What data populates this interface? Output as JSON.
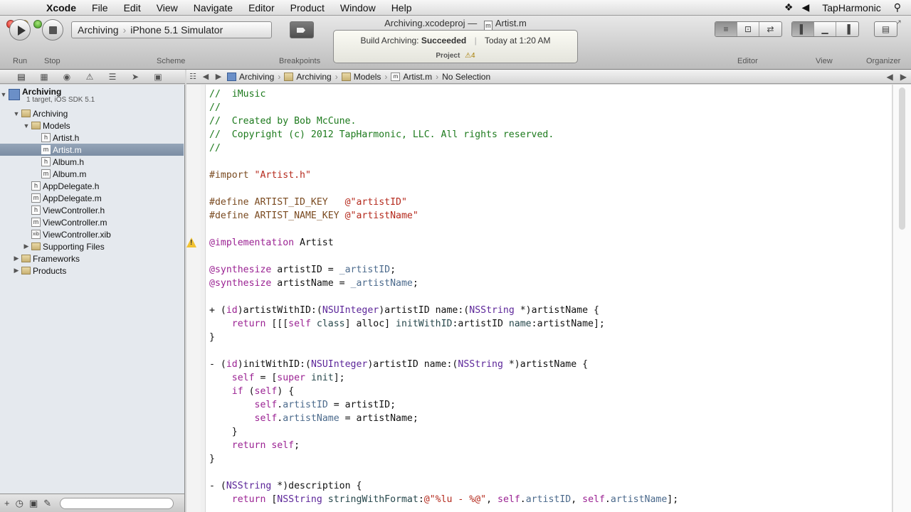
{
  "menubar": {
    "app": "Xcode",
    "items": [
      "File",
      "Edit",
      "View",
      "Navigate",
      "Editor",
      "Product",
      "Window",
      "Help"
    ],
    "user": "TapHarmonic"
  },
  "window": {
    "title_project": "Archiving.xcodeproj",
    "title_dash": "—",
    "title_file_icon": "m",
    "title_file": "Artist.m"
  },
  "toolbar": {
    "run_label": "Run",
    "stop_label": "Stop",
    "scheme_label": "Scheme",
    "scheme_name": "Archiving",
    "scheme_sep": "›",
    "scheme_destination": "iPhone 5.1 Simulator",
    "breakpoints_label": "Breakpoints",
    "editor_label": "Editor",
    "view_label": "View",
    "organizer_label": "Organizer"
  },
  "activity": {
    "build_prefix": "Build Archiving:",
    "build_status": "Succeeded",
    "pipe": "|",
    "time": "Today at 1:20 AM",
    "project_label": "Project",
    "warning_glyph": "⚠",
    "warning_count": "4"
  },
  "navigator": {
    "project_name": "Archiving",
    "project_sub": "1 target, iOS SDK 5.1",
    "items": [
      {
        "label": "Archiving",
        "icon": "folder"
      },
      {
        "label": "Models",
        "icon": "folder"
      },
      {
        "label": "Artist.h",
        "icon": "h"
      },
      {
        "label": "Artist.m",
        "icon": "m"
      },
      {
        "label": "Album.h",
        "icon": "h"
      },
      {
        "label": "Album.m",
        "icon": "m"
      },
      {
        "label": "AppDelegate.h",
        "icon": "h"
      },
      {
        "label": "AppDelegate.m",
        "icon": "m"
      },
      {
        "label": "ViewController.h",
        "icon": "h"
      },
      {
        "label": "ViewController.m",
        "icon": "m"
      },
      {
        "label": "ViewController.xib",
        "icon": "xib"
      },
      {
        "label": "Supporting Files",
        "icon": "folder"
      },
      {
        "label": "Frameworks",
        "icon": "folder"
      },
      {
        "label": "Products",
        "icon": "folder"
      }
    ]
  },
  "jumpbar": {
    "crumbs": [
      "Archiving",
      "Archiving",
      "Models",
      "Artist.m",
      "No Selection"
    ]
  },
  "code": {
    "l1": "//  iMusic",
    "l2": "//",
    "l3": "//  Created by Bob McCune.",
    "l4": "//  Copyright (c) 2012 TapHarmonic, LLC. All rights reserved.",
    "l5": "//",
    "import_kw": "#import",
    "import_str": "\"Artist.h\"",
    "define_kw": "#define",
    "define1_name": " ARTIST_ID_KEY   ",
    "define1_val": "@\"artistID\"",
    "define2_name": " ARTIST_NAME_KEY ",
    "define2_val": "@\"artistName\"",
    "impl_kw": "@implementation",
    "impl_name": " Artist",
    "synth_kw": "@synthesize",
    "synth1": " artistID = ",
    "synth1_ivar": "_artistID",
    "synth2": " artistName = ",
    "synth2_ivar": "_artistName",
    "m1_a": "+ (",
    "id_kw": "id",
    "m1_b": ")artistWithID:(",
    "nsuinteger": "NSUInteger",
    "m1_c": ")artistID name:(",
    "nsstring": "NSString",
    "m1_d": " *)artistName {",
    "m1_body_a": "    return [[[",
    "self_kw": "self",
    "class_kw": " class",
    "m1_body_b": "] alloc] ",
    "m1_body_c": "initWithID",
    "m1_body_d": ":artistID ",
    "name_kw": "name",
    "m1_body_e": ":artistName];",
    "close": "}",
    "m2_a": "- (",
    "m2_b": ")initWithID:(",
    "m2_c": ")artistID name:(",
    "m2_d": " *)artistName {",
    "m2_l1_a": "    ",
    "m2_l1_b": " = [",
    "super_kw": "super",
    "init_kw": " init",
    "m2_l1_c": "];",
    "if_kw": "if",
    "m2_l2_a": "    ",
    "m2_l2_b": " (",
    "m2_l2_c": ") {",
    "m2_l3_a": "        ",
    "dot": ".",
    "prop_artistID": "artistID",
    "m2_l3_b": " = artistID;",
    "prop_artistName": "artistName",
    "m2_l4_b": " = artistName;",
    "m2_close_inner": "    }",
    "return_kw": "return",
    "m2_ret": "    ",
    "m2_ret_b": " ",
    "m2_ret_c": ";",
    "m3_a": "- (",
    "m3_b": " *)description {",
    "m3_l1_a": "    ",
    "m3_l1_b": " [",
    "m3_l1_c": " ",
    "fmt_kw": "stringWithFormat",
    "m3_l1_d": ":",
    "fmt_str": "@\"%lu - %@\"",
    "m3_l1_e": ", ",
    "m3_l1_f": ", ",
    "m3_l1_g": "];"
  },
  "colors": {
    "comment": "#1d7a1d",
    "keyword": "#9b2393",
    "string": "#b52a1d",
    "class": "#5c2699",
    "selection": "#7b8da3"
  }
}
